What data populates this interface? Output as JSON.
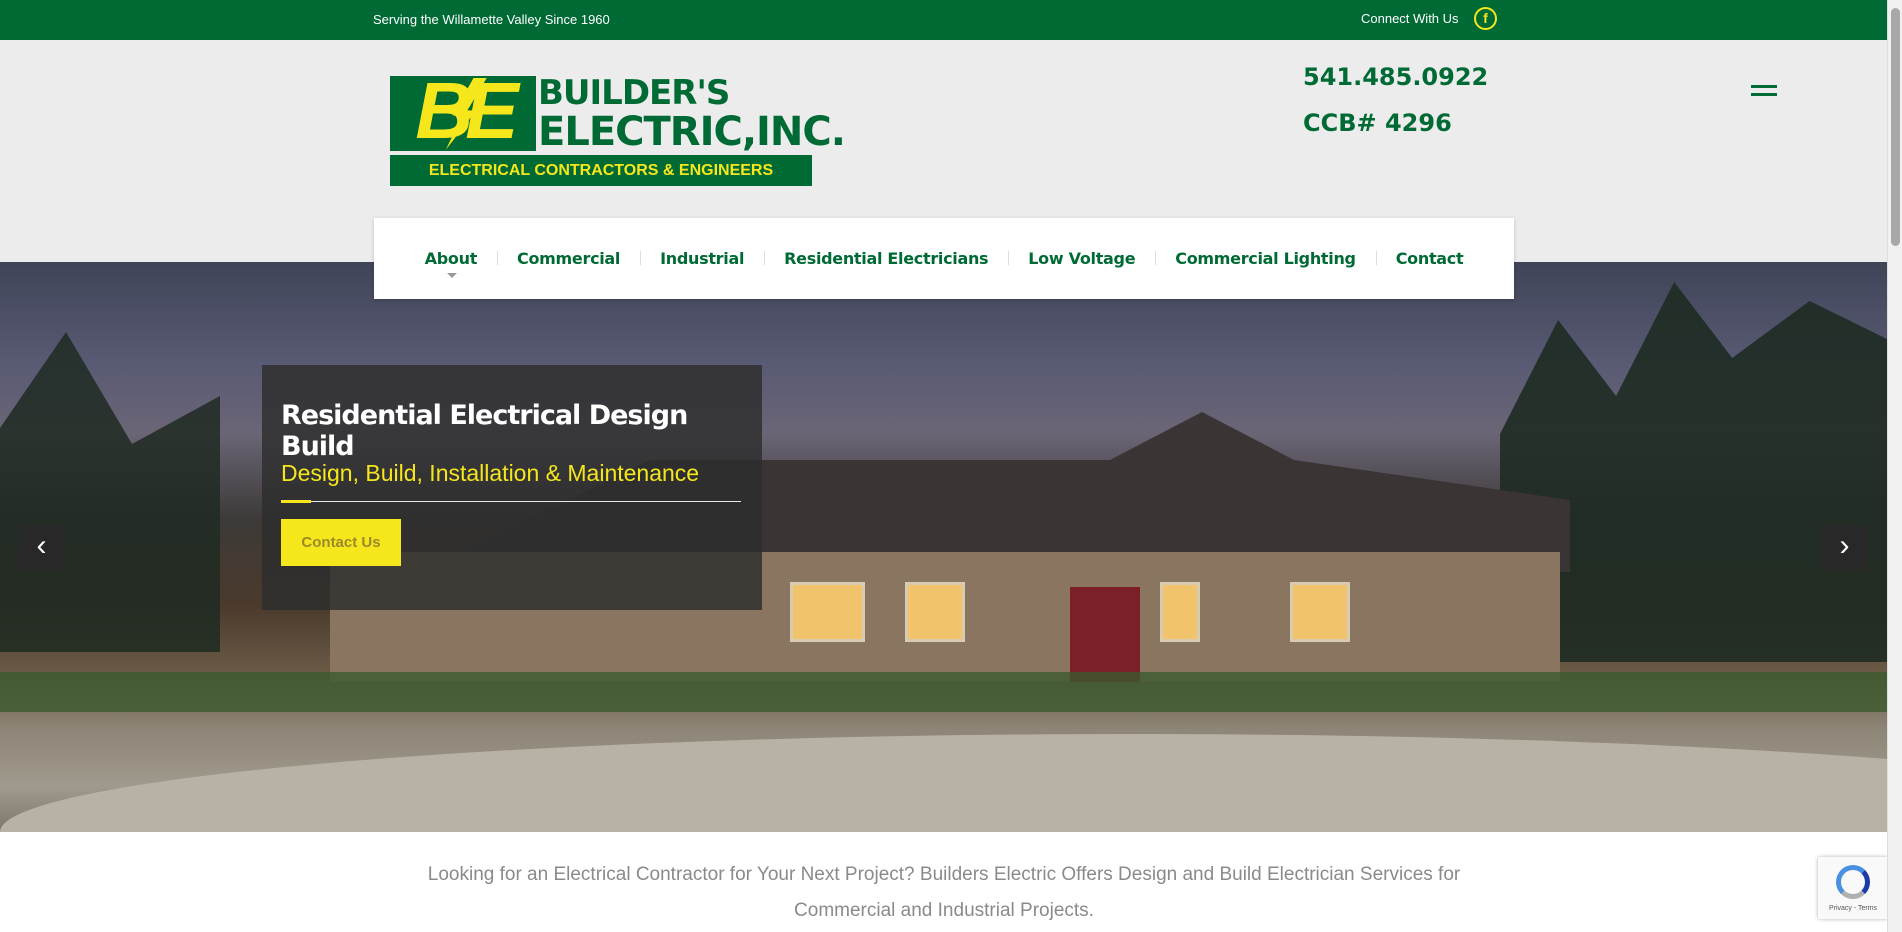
{
  "topbar": {
    "tagline": "Serving the Willamette Valley Since 1960",
    "connect_label": "Connect With Us",
    "facebook_glyph": "f"
  },
  "logo": {
    "mark": "BE",
    "line1": "BUILDER'S",
    "line2": "ELECTRIC,INC.",
    "tagline": "ELECTRICAL CONTRACTORS & ENGINEERS"
  },
  "contact": {
    "phone": "541.485.0922",
    "ccb": "CCB# 4296"
  },
  "nav": {
    "items": [
      {
        "label": "About"
      },
      {
        "label": "Commercial"
      },
      {
        "label": "Industrial"
      },
      {
        "label": "Residential Electricians"
      },
      {
        "label": "Low Voltage"
      },
      {
        "label": "Commercial Lighting"
      },
      {
        "label": "Contact"
      }
    ]
  },
  "hero": {
    "title": "Residential Electrical Design Build",
    "subtitle": "Design, Build, Installation & Maintenance",
    "button_label": "Contact Us",
    "prev_glyph": "‹",
    "next_glyph": "›"
  },
  "intro": {
    "text": "Looking for an Electrical Contractor for Your Next Project? Builders Electric Offers Design and Build Electrician Services for Commercial and Industrial Projects."
  },
  "recaptcha": {
    "links": "Privacy - Terms"
  },
  "colors": {
    "brand_green": "#006a35",
    "brand_yellow": "#f5e71c"
  },
  "icons": [
    "facebook-icon",
    "menu-icon",
    "chevron-left-icon",
    "chevron-right-icon",
    "recaptcha-icon"
  ]
}
